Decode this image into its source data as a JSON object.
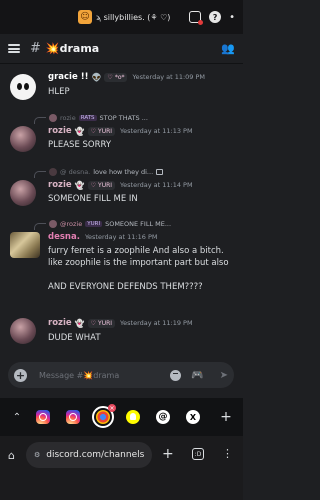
{
  "statusbar": {
    "tab_title": "ϡ silly​billies. (⚘ ♡)",
    "icons": [
      "app-icon",
      "record-icon",
      "help-icon",
      "dot-icon"
    ]
  },
  "channel": {
    "name": "💥drama",
    "hash": "#"
  },
  "messages": [
    {
      "author": "gracie !!",
      "alien": "👽",
      "tag": "*o*",
      "time": "Yesterday at 11:09 PM",
      "text": "HLEP"
    },
    {
      "reply_author": "rozie",
      "reply_tag": "RATS",
      "reply_text": "STOP THATS ...",
      "author": "rozie",
      "tag": "YURI",
      "time": "Yesterday at 11:13 PM",
      "text": "PLEASE SORRY"
    },
    {
      "reply_author": "@ desna.",
      "reply_text": "love how they di...",
      "author": "rozie",
      "tag": "YURI",
      "time": "Yesterday at 11:14 PM",
      "text": "SOMEONE FILL ME IN"
    },
    {
      "reply_author": "@rozie",
      "reply_tag": "YURI",
      "reply_text": "SOMEONE FILL ME...",
      "author": "desna.",
      "time": "Yesterday at 11:16 PM",
      "text_1": "furry ferret is a zoophile And also a bitch. like zoophile is the important part but also",
      "text_2": "AND EVERYONE DEFENDS THEM????"
    },
    {
      "author": "rozie",
      "tag": "YURI",
      "time": "Yesterday at 11:19 PM",
      "text": "DUDE WHAT"
    }
  ],
  "composer": {
    "placeholder": "Message #💥drama",
    "value": ""
  },
  "browser": {
    "url": "discord.com/channels",
    "tabs_count": ":D"
  }
}
